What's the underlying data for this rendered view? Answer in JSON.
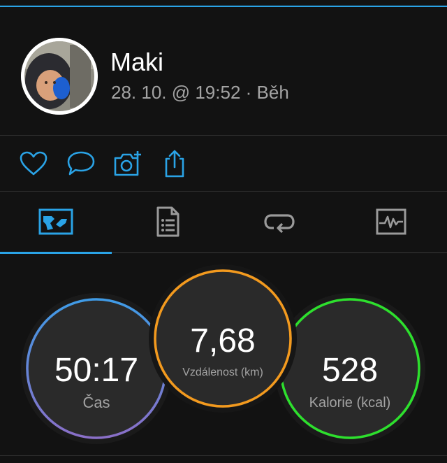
{
  "activity": {
    "user_name": "Maki",
    "meta": "28. 10. @ 19:52 · Běh"
  },
  "actions": [
    {
      "name": "like-button",
      "icon": "heart-icon"
    },
    {
      "name": "comment-button",
      "icon": "comment-icon"
    },
    {
      "name": "add-photo-button",
      "icon": "camera-plus-icon"
    },
    {
      "name": "share-button",
      "icon": "share-icon"
    }
  ],
  "tabs": [
    {
      "name": "tab-overview",
      "icon": "overview-map-icon",
      "active": true
    },
    {
      "name": "tab-details",
      "icon": "document-list-icon",
      "active": false
    },
    {
      "name": "tab-laps",
      "icon": "repeat-icon",
      "active": false
    },
    {
      "name": "tab-charts",
      "icon": "activity-chart-icon",
      "active": false
    }
  ],
  "stats": {
    "time": {
      "value": "50:17",
      "label": "Čas"
    },
    "distance": {
      "value": "7,68",
      "label": "Vzdálenost (km)"
    },
    "calories": {
      "value": "528",
      "label": "Kalorie (kcal)"
    }
  },
  "colors": {
    "accent": "#2aa3e6",
    "distance_ring": "#f39a1e",
    "calories_ring": "#2de02d",
    "time_ring_start": "#3f9be6",
    "time_ring_end": "#8a6fc8"
  }
}
